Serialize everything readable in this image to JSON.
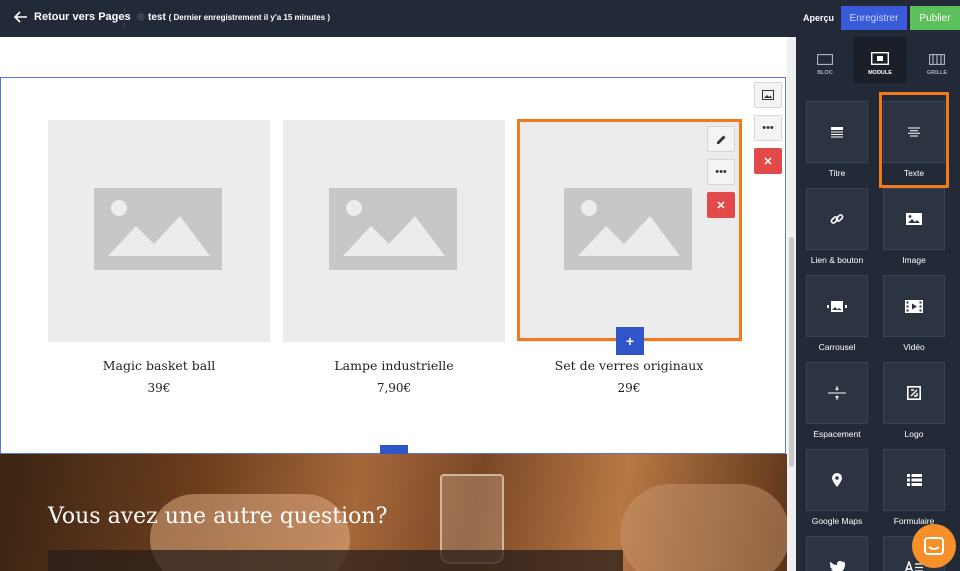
{
  "topbar": {
    "back_label": "Retour vers Pages",
    "page_name": "test",
    "save_status": "( Dernier enregistrement il y'a 15 minutes )",
    "preview_label": "Aperçu",
    "save_label": "Enregistrer",
    "publish_label": "Publier"
  },
  "products": [
    {
      "name": "Magic basket ball",
      "price": "39€"
    },
    {
      "name": "Lampe industrielle",
      "price": "7,90€"
    },
    {
      "name": "Set de verres originaux",
      "price": "29€"
    }
  ],
  "banner": {
    "headline": "Vous avez une autre question?"
  },
  "panel": {
    "tabs": [
      {
        "label": "BLOC",
        "icon": "bloc-icon"
      },
      {
        "label": "MODULE",
        "icon": "module-icon",
        "active": true
      },
      {
        "label": "GRILLE",
        "icon": "grille-icon"
      }
    ],
    "modules": [
      {
        "label": "Titre",
        "icon": "title-icon"
      },
      {
        "label": "Texte",
        "icon": "text-icon",
        "selected": true
      },
      {
        "label": "Lien & bouton",
        "icon": "link-icon"
      },
      {
        "label": "Image",
        "icon": "image-icon"
      },
      {
        "label": "Carrousel",
        "icon": "carousel-icon"
      },
      {
        "label": "Vidéo",
        "icon": "video-icon"
      },
      {
        "label": "Espacement",
        "icon": "spacing-icon"
      },
      {
        "label": "Logo",
        "icon": "logo-icon"
      },
      {
        "label": "Google Maps",
        "icon": "map-pin-icon"
      },
      {
        "label": "Formulaire",
        "icon": "form-icon"
      }
    ]
  },
  "colors": {
    "topbar_bg": "#232a37",
    "save_button": "#3a5bd9",
    "publish_button": "#5cc05c",
    "selection": "#f07a1c",
    "delete": "#e24a4a",
    "add_button": "#2f55c9",
    "chat_bubble": "#f7902b"
  }
}
